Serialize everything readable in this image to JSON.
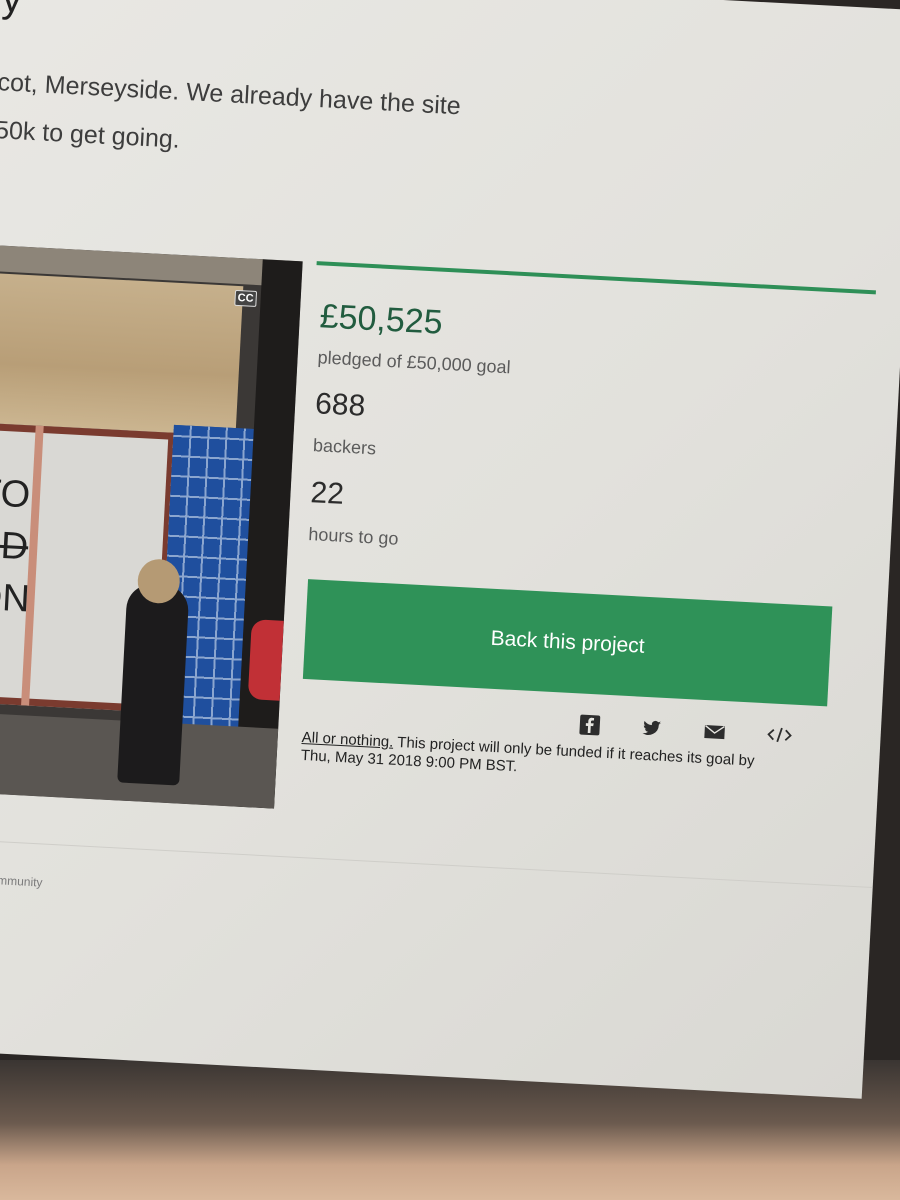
{
  "header": {
    "title_fragment": "y"
  },
  "blurb": {
    "line1": "cot, Merseyside. We already have the site",
    "line2": "50k to get going."
  },
  "photo": {
    "badge": "CC",
    "graffiti": [
      "TO",
      "ED",
      "ON"
    ]
  },
  "stats": {
    "pledged_amount": "£50,525",
    "pledged_label": "pledged of £50,000 goal",
    "backers_count": "688",
    "backers_label": "backers",
    "time_value": "22",
    "time_label": "hours to go"
  },
  "cta": {
    "back_label": "Back this project"
  },
  "share_icons": [
    "facebook-icon",
    "twitter-icon",
    "email-icon",
    "embed-icon"
  ],
  "funding_note": {
    "link_text": "All or nothing.",
    "text": " This project will only be funded if it reaches its goal by Thu, May 31 2018 9:00 PM BST."
  },
  "footer": {
    "community_label": "Community"
  },
  "colors": {
    "accent": "#2f9258",
    "pledged_text": "#215c3f"
  }
}
